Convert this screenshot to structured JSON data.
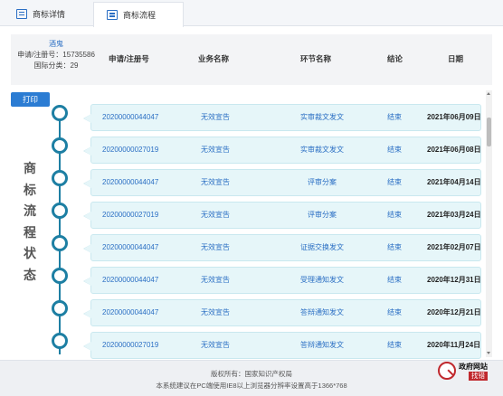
{
  "tabs": [
    {
      "label": "商标详情",
      "active": false
    },
    {
      "label": "商标流程",
      "active": true
    }
  ],
  "header": {
    "applicant_name": "酒鬼",
    "reg_number": "申请/注册号：15735586",
    "intl_class": "国际分类：29",
    "columns": {
      "reg_no": "申请/注册号",
      "business": "业务名称",
      "step": "环节名称",
      "result": "结论",
      "date": "日期"
    }
  },
  "print_label": "打印",
  "side_label": [
    "商",
    "标",
    "流",
    "程",
    "状",
    "态"
  ],
  "rows": [
    {
      "reg_no": "20200000044047",
      "business": "无效宣告",
      "step": "实审裁文发文",
      "result": "结束",
      "date": "2021年06月09日"
    },
    {
      "reg_no": "20200000027019",
      "business": "无效宣告",
      "step": "实审裁文发文",
      "result": "结束",
      "date": "2021年06月08日"
    },
    {
      "reg_no": "20200000044047",
      "business": "无效宣告",
      "step": "评审分案",
      "result": "结束",
      "date": "2021年04月14日"
    },
    {
      "reg_no": "20200000027019",
      "business": "无效宣告",
      "step": "评审分案",
      "result": "结束",
      "date": "2021年03月24日"
    },
    {
      "reg_no": "20200000044047",
      "business": "无效宣告",
      "step": "证据交换发文",
      "result": "结束",
      "date": "2021年02月07日"
    },
    {
      "reg_no": "20200000044047",
      "business": "无效宣告",
      "step": "受理通知发文",
      "result": "结束",
      "date": "2020年12月31日"
    },
    {
      "reg_no": "20200000044047",
      "business": "无效宣告",
      "step": "答辩通知发文",
      "result": "结束",
      "date": "2020年12月21日"
    },
    {
      "reg_no": "20200000027019",
      "business": "无效宣告",
      "step": "答辩通知发文",
      "result": "结束",
      "date": "2020年11月24日"
    }
  ],
  "footer": {
    "copyright": "版权所有：国家知识产权局",
    "browser_note": "本系统建议在PC端使用IE8以上浏览器分辨率设置高于1366*768"
  },
  "watermark": {
    "line1": "政府网站",
    "line2": "找错"
  },
  "colors": {
    "accent": "#2b6fc4",
    "timeline": "#1d7fa3",
    "row_bg": "#e6f6f9",
    "print_button": "#2b7cd3",
    "watermark_red": "#c0282d"
  }
}
